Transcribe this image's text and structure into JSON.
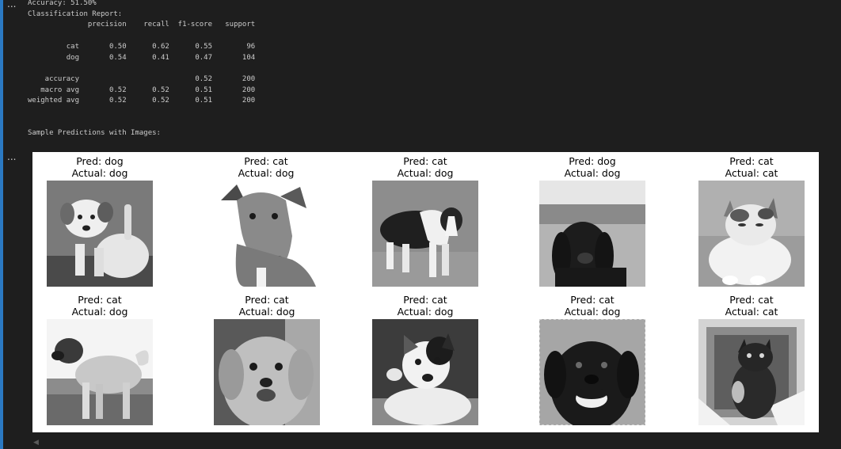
{
  "cell_toolbar": {
    "text_output_label": "...",
    "figure_output_label": "..."
  },
  "output": {
    "accuracy_line": "Accuracy: 51.50%",
    "report_title": "Classification Report:",
    "report_header": "              precision    recall  f1-score   support",
    "rows": [
      "         cat       0.50      0.62      0.55        96",
      "         dog       0.54      0.41      0.47       104",
      "    accuracy                           0.52       200",
      "   macro avg       0.52      0.52      0.51       200",
      "weighted avg       0.52      0.52      0.51       200"
    ],
    "samples_title": "Sample Predictions with Images:"
  },
  "figure": {
    "samples": [
      {
        "pred": "Pred: dog",
        "actual": "Actual: dog",
        "image": "puppy-photo"
      },
      {
        "pred": "Pred: cat",
        "actual": "Actual: dog",
        "image": "greyhound-photo"
      },
      {
        "pred": "Pred: cat",
        "actual": "Actual: dog",
        "image": "border-collie-photo"
      },
      {
        "pred": "Pred: dog",
        "actual": "Actual: dog",
        "image": "black-spaniel-photo"
      },
      {
        "pred": "Pred: cat",
        "actual": "Actual: cat",
        "image": "sitting-cat-photo"
      },
      {
        "pred": "Pred: cat",
        "actual": "Actual: dog",
        "image": "shepherd-dog-photo"
      },
      {
        "pred": "Pred: cat",
        "actual": "Actual: dog",
        "image": "golden-retriever-photo"
      },
      {
        "pred": "Pred: cat",
        "actual": "Actual: dog",
        "image": "jack-russell-photo"
      },
      {
        "pred": "Pred: cat",
        "actual": "Actual: dog",
        "image": "black-labrador-photo"
      },
      {
        "pred": "Pred: cat",
        "actual": "Actual: cat",
        "image": "dark-cat-photo"
      }
    ]
  },
  "scrollbar": {
    "left_arrow": "◀"
  },
  "colors": {
    "background": "#1e1e1e",
    "text": "#cccccc",
    "accent_bar": "#2b79c2",
    "figure_background": "#ffffff"
  }
}
